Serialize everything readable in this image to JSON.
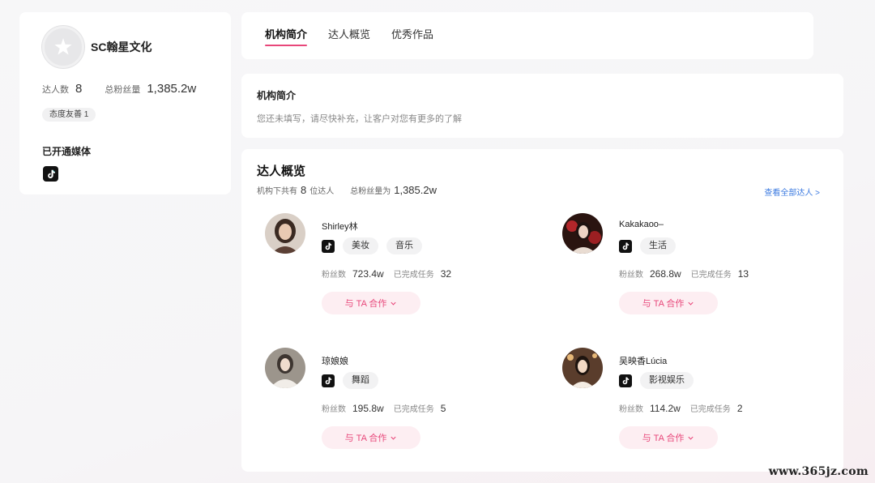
{
  "org": {
    "name": "SC翰星文化",
    "talent_count_label": "达人数",
    "talent_count": "8",
    "fans_label": "总粉丝量",
    "fans": "1,385.2w",
    "badge": "态度友善 1",
    "media_title": "已开通媒体",
    "media_icon": "tiktok-icon"
  },
  "tabs": [
    {
      "label": "机构简介",
      "active": true
    },
    {
      "label": "达人概览",
      "active": false
    },
    {
      "label": "优秀作品",
      "active": false
    }
  ],
  "intro": {
    "title": "机构简介",
    "text": "您还未填写，请尽快补充，让客户对您有更多的了解"
  },
  "overview": {
    "title": "达人概览",
    "sub_prefix": "机构下共有",
    "count": "8",
    "sub_suffix": "位达人",
    "fans_prefix": "总粉丝量为",
    "fans": "1,385.2w",
    "view_all": "查看全部达人 >"
  },
  "influencers": [
    {
      "name": "Shirley林",
      "tags": [
        "美妆",
        "音乐"
      ],
      "fans_label": "粉丝数",
      "fans": "723.4w",
      "tasks_label": "已完成任务",
      "tasks": "32",
      "button": "与 TA 合作",
      "avatar_color": "#8a6a5a"
    },
    {
      "name": "Kakakaoo–",
      "tags": [
        "生活"
      ],
      "fans_label": "粉丝数",
      "fans": "268.8w",
      "tasks_label": "已完成任务",
      "tasks": "13",
      "button": "与 TA 合作",
      "avatar_color": "#b0302f"
    },
    {
      "name": "琼娘娘",
      "tags": [
        "舞蹈"
      ],
      "fans_label": "粉丝数",
      "fans": "195.8w",
      "tasks_label": "已完成任务",
      "tasks": "5",
      "button": "与 TA 合作",
      "avatar_color": "#b9b4ac"
    },
    {
      "name": "吴映香Lúcia",
      "tags": [
        "影视娱乐"
      ],
      "fans_label": "粉丝数",
      "fans": "114.2w",
      "tasks_label": "已完成任务",
      "tasks": "2",
      "button": "与 TA 合作",
      "avatar_color": "#6b4a35"
    }
  ],
  "watermark": "www.365jz.com",
  "colors": {
    "accent": "#e8477a",
    "link": "#3d7be0",
    "button_bg": "#fdeef2"
  }
}
